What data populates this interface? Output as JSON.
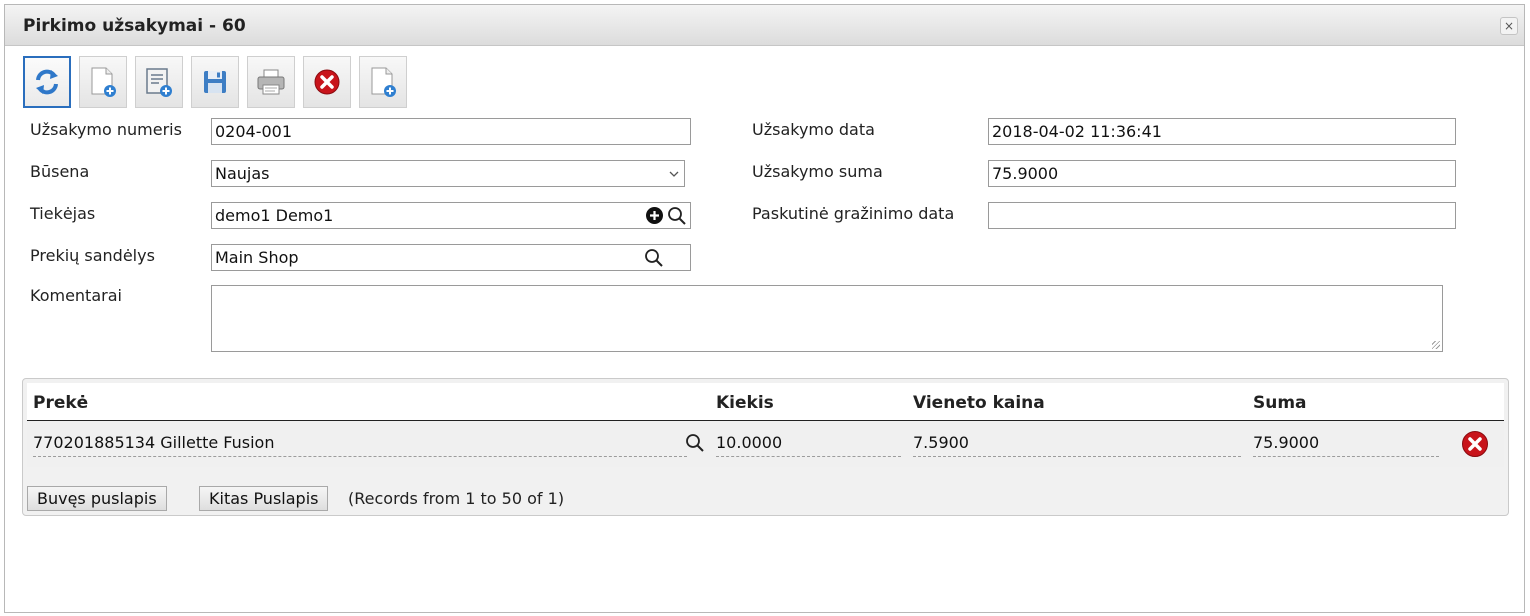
{
  "window": {
    "title": "Pirkimo užsakymai - 60",
    "close_glyph": "×"
  },
  "toolbar": {
    "buttons": [
      {
        "name": "refresh-icon"
      },
      {
        "name": "new-document-icon"
      },
      {
        "name": "new-list-icon"
      },
      {
        "name": "save-icon"
      },
      {
        "name": "print-icon"
      },
      {
        "name": "delete-icon"
      },
      {
        "name": "add-document-icon"
      }
    ]
  },
  "form": {
    "order_number": {
      "label": "Užsakymo numeris",
      "value": "0204-001"
    },
    "status": {
      "label": "Būsena",
      "value": "Naujas"
    },
    "supplier": {
      "label": "Tiekėjas",
      "value": "demo1 Demo1"
    },
    "warehouse": {
      "label": "Prekių sandėlys",
      "value": "Main Shop"
    },
    "comments": {
      "label": "Komentarai",
      "value": ""
    },
    "order_date": {
      "label": "Užsakymo data",
      "value": "2018-04-02 11:36:41"
    },
    "order_sum": {
      "label": "Užsakymo suma",
      "value": "75.9000"
    },
    "last_return_date": {
      "label": "Paskutinė gražinimo data",
      "value": ""
    }
  },
  "grid": {
    "columns": [
      "Prekė",
      "Kiekis",
      "Vieneto kaina",
      "Suma"
    ],
    "rows": [
      {
        "product": "770201885134 Gillette Fusion",
        "qty": "10.0000",
        "unit_price": "7.5900",
        "sum": "75.9000"
      }
    ],
    "pager": {
      "prev_label": "Buvęs puslapis",
      "next_label": "Kitas Puslapis",
      "records_text": "(Records from 1 to 50 of 1)"
    }
  },
  "colors": {
    "accent": "#2a6ebd",
    "delete": "#c8141b"
  }
}
